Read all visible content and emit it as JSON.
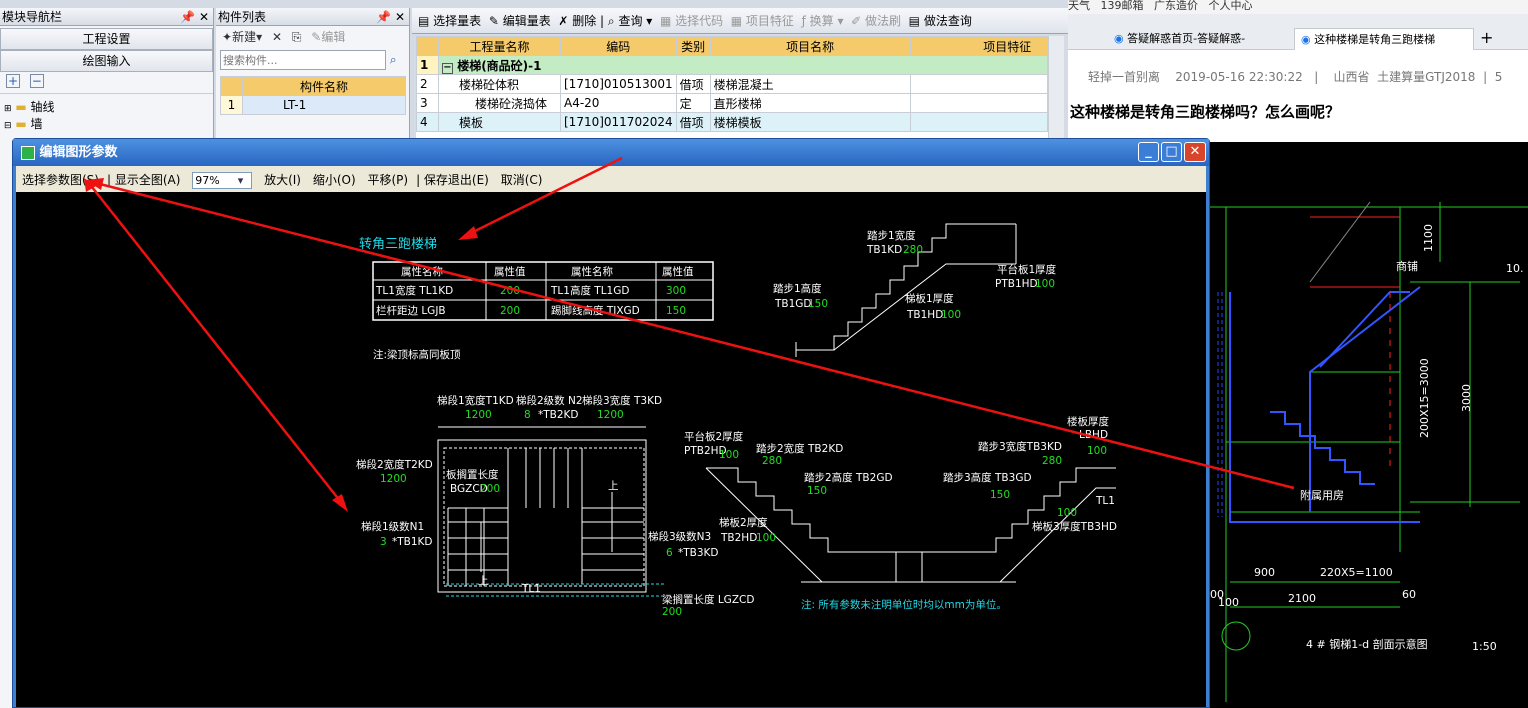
{
  "nav": {
    "title": "模块导航栏",
    "btn1": "工程设置",
    "btn2": "绘图输入",
    "tree": [
      "轴线",
      "墙"
    ]
  },
  "comp": {
    "title": "构件列表",
    "new": "新建",
    "edit": "编辑",
    "search_ph": "搜索构件...",
    "col": "构件名称",
    "row_num": "1",
    "row_name": "LT-1"
  },
  "toolbar": {
    "items": [
      "选择量表",
      "编辑量表",
      "删除",
      "查询",
      "选择代码",
      "项目特征",
      "换算",
      "做法刷",
      "做法查询"
    ]
  },
  "qtable": {
    "headers": [
      "工程量名称",
      "编码",
      "类别",
      "项目名称",
      "项目特征"
    ],
    "rows": [
      {
        "n": "1",
        "name": "楼梯(商品砼)-1",
        "code": "",
        "type": "",
        "item": ""
      },
      {
        "n": "2",
        "name": "楼梯砼体积",
        "code": "[1710]010513001",
        "type": "借项",
        "item": "楼梯混凝土"
      },
      {
        "n": "3",
        "name": "楼梯砼浇捣体",
        "code": "A4-20",
        "type": "定",
        "item": "直形楼梯"
      },
      {
        "n": "4",
        "name": "模板",
        "code": "[1710]011702024",
        "type": "借项",
        "item": "楼梯模板"
      }
    ]
  },
  "dialog": {
    "title": "编辑图形参数",
    "tb": {
      "select": "选择参数图(S)",
      "full": "显示全图(A)",
      "zoom": "97%",
      "zin": "放大(I)",
      "zout": "缩小(O)",
      "pan": "平移(P)",
      "save": "保存退出(E)",
      "cancel": "取消(C)"
    }
  },
  "cad": {
    "title": "转角三跑楼梯",
    "ptable": {
      "h": [
        "属性名称",
        "属性值",
        "属性名称",
        "属性值"
      ],
      "r": [
        [
          "TL1宽度 TL1KD",
          "200",
          "TL1高度 TL1GD",
          "300"
        ],
        [
          "栏杆距边 LGJB",
          "200",
          "踢脚线高度 TJXGD",
          "150"
        ]
      ]
    },
    "note1": "注:梁顶标高同板顶",
    "note2": "注: 所有参数未注明单位时均以mm为单位。",
    "tr": {
      "tb1kd_l": "踏步1宽度",
      "tb1kd_c": "TB1KD",
      "tb1kd_v": "280",
      "tb1gd_l": "踏步1高度",
      "tb1gd_c": "TB1GD",
      "tb1gd_v": "150",
      "tb1hd_l": "梯板1厚度",
      "tb1hd_c": "TB1HD",
      "tb1hd_v": "100",
      "ptb1_l": "平台板1厚度",
      "ptb1_c": "PTB1HD",
      "ptb1_v": "100"
    },
    "plan": {
      "t1": "梯段1宽度T1KD",
      "t1v": "1200",
      "n2": "梯段2级数 N2",
      "n2v": "8",
      "n2c": "*TB2KD",
      "t3": "梯段3宽度 T3KD",
      "t3v": "1200",
      "t2": "梯段2宽度T2KD",
      "t2v": "1200",
      "bgz": "板搁置长度",
      "bgzc": "BGZCD",
      "bgzv": "200",
      "n1": "梯段1级数N1",
      "n1v": "3",
      "n1c": "*TB1KD",
      "n3": "梯段3级数N3",
      "n3v": "6",
      "n3c": "*TB3KD",
      "up1": "上",
      "up2": "上",
      "tl1": "TL1",
      "lgz": "梁搁置长度 LGZCD",
      "lgzv": "200"
    },
    "sec": {
      "ptb2": "平台板2厚度",
      "ptb2c": "PTB2HD",
      "ptb2v": "100",
      "tb2kd": "踏步2宽度 TB2KD",
      "tb2kdv": "280",
      "tb2gd": "踏步2高度 TB2GD",
      "tb2gdv": "150",
      "tb2hd": "梯板2厚度",
      "tb2hdc": "TB2HD",
      "tb2hdv": "100",
      "tb3kd": "踏步3宽度TB3KD",
      "tb3kdv": "280",
      "tb3gd": "踏步3高度 TB3GD",
      "tb3gdv": "150",
      "tbhd": "楼板厚度",
      "tbhdc": "LBHD",
      "tbhdv": "100",
      "tb3hd": "梯板3厚度TB3HD",
      "tb3hdv": "100",
      "tl1": "TL1"
    }
  },
  "browser": {
    "bm": [
      "天气",
      "139邮箱",
      "广东造价",
      "个人中心"
    ],
    "tab1": "答疑解惑首页-答疑解惑-",
    "tab2": "这种楼梯是转角三跑楼梯",
    "meta": {
      "user": "轻掉一首别离",
      "date": "2019-05-16 22:30:22",
      "sep": "|",
      "prov": "山西省",
      "soft": "土建算量GTJ2018",
      "sep2": "|",
      "num": "5"
    },
    "question": "这种楼梯是转角三跑楼梯吗？怎么画呢？"
  },
  "photo": {
    "labels": {
      "a": "1100",
      "b": "200X15=3000",
      "c": "3000",
      "d": "900",
      "e": "220X5=1100",
      "f": "2100",
      "g": "60",
      "h": "100",
      "i": "00",
      "j": "附属用房",
      "k": "商铺",
      "l": "10."
    },
    "caption": "4 # 钢梯1-d 剖面示意图",
    "scale": "1:50"
  }
}
